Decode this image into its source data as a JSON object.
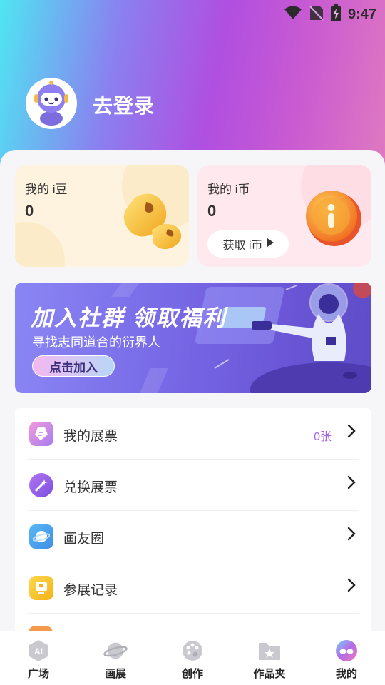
{
  "status_bar": {
    "time": "9:47",
    "icons": [
      "wifi-icon",
      "no-sim-icon",
      "battery-charging-icon"
    ]
  },
  "profile": {
    "login_text": "去登录",
    "avatar_icon": "robot-avatar-icon"
  },
  "cards": {
    "beans": {
      "title": "我的 i豆",
      "value": "0",
      "icon": "bean-icon"
    },
    "coins": {
      "title": "我的 i币",
      "value": "0",
      "button_label": "获取 i币",
      "icon": "coin-icon"
    }
  },
  "banner": {
    "title": "加入社群 领取福利",
    "subtitle": "寻找志同道合的衍界人",
    "button_label": "点击加入"
  },
  "menu": {
    "items": [
      {
        "label": "我的展票",
        "extra": "0张",
        "icon": "ticket-icon"
      },
      {
        "label": "兑换展票",
        "extra": "",
        "icon": "magic-wand-icon"
      },
      {
        "label": "画友圈",
        "extra": "",
        "icon": "planet-icon"
      },
      {
        "label": "参展记录",
        "extra": "",
        "icon": "trophy-icon"
      }
    ]
  },
  "tabs": [
    {
      "label": "广场",
      "icon": "ai-icon"
    },
    {
      "label": "画展",
      "icon": "planet-icon"
    },
    {
      "label": "创作",
      "icon": "palette-icon"
    },
    {
      "label": "作品夹",
      "icon": "folder-star-icon"
    },
    {
      "label": "我的",
      "icon": "mine-avatar-icon"
    }
  ],
  "colors": {
    "accent": "#a365e6",
    "header_gradient_start": "#4fe6f2",
    "header_gradient_end": "#e07ac0"
  }
}
